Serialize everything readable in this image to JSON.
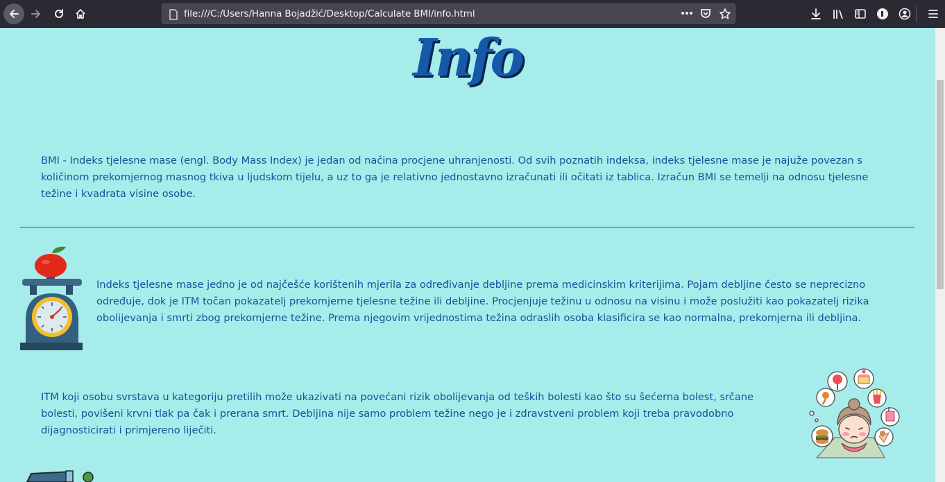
{
  "browser": {
    "url": "file:///C:/Users/Hanna Bojadžić/Desktop/Calculate BMI/info.html"
  },
  "page": {
    "title": "Info",
    "paragraph_1": "BMI - Indeks tjelesne mase (engl. Body Mass Index) je jedan od načina procjene uhranjenosti. Od svih poznatih indeksa, indeks tjelesne mase je najuže povezan s količinom prekomjernog masnog tkiva u ljudskom tijelu, a uz to ga je relativno jednostavno izračunati ili očitati iz tablica. Izračun BMI se temelji na odnosu tjelesne težine i kvadrata visine osobe.",
    "paragraph_2": "Indeks tjelesne mase jedno je od najčešće korištenih mjerila za određivanje debljine prema medicinskim kriterijima. Pojam debljine često se neprecizno određuje, dok je ITM točan pokazatelj prekomjerne tjelesne težine ili debljine. Procjenjuje težinu u odnosu na visinu i može poslužiti kao pokazatelj rizika obolijevanja i smrti zbog prekomjerne težine. Prema njegovim vrijednostima težina odraslih osoba klasificira se kao normalna, prekomjerna ili debljina.",
    "paragraph_3": "ITM koji osobu svrstava u kategoriju pretilih može ukazivati na povećani rizik obolijevanja od teških bolesti kao što su šećerna bolest, srčane bolesti, povišeni krvni tlak pa čak i prerana smrt. Debljina nije samo problem težine nego je i zdravstveni problem koji treba pravodobno dijagnosticirati i primjereno liječiti."
  },
  "colors": {
    "page_background": "#a6eceb",
    "text": "#1b4f98",
    "title": "#1559a8",
    "chrome": "#2b2a33"
  },
  "icons": {
    "back": "arrow-left-icon",
    "forward": "arrow-right-icon",
    "reload": "reload-icon",
    "home": "home-icon",
    "page": "file-icon",
    "page_actions": "more-dots-icon",
    "pocket": "pocket-icon",
    "bookmark": "star-icon",
    "downloads": "download-icon",
    "library": "library-icon",
    "sidebar": "sidebar-icon",
    "extension": "extension-icon",
    "account": "account-icon",
    "menu": "hamburger-menu-icon"
  }
}
